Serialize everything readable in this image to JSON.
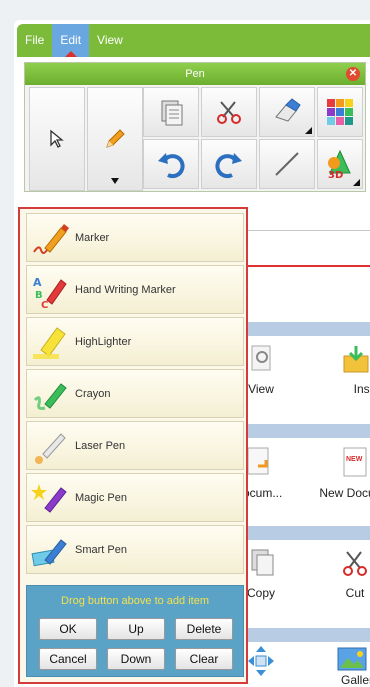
{
  "menubar": {
    "items": [
      {
        "label": "File"
      },
      {
        "label": "Edit"
      },
      {
        "label": "View"
      }
    ],
    "active": "Edit"
  },
  "pen_panel": {
    "title": "Pen",
    "tools": [
      "select-arrow-icon",
      "pencil-icon",
      "paste-icon",
      "scissors-icon",
      "eraser-icon",
      "color-grid-icon",
      "undo-icon",
      "redo-icon",
      "line-icon",
      "shapes-3d-icon"
    ]
  },
  "background": {
    "row1": [
      "View",
      "Inser"
    ],
    "row2": [
      "t Docum...",
      "New Docu"
    ],
    "row2_badge": "NEW",
    "row3": [
      "Copy",
      "Cut"
    ],
    "row4": [
      "",
      "Galler"
    ]
  },
  "dropdown": {
    "items": [
      {
        "label": "Marker",
        "icon": "marker-icon"
      },
      {
        "label": "Hand Writing Marker",
        "icon": "handwriting-marker-icon"
      },
      {
        "label": "HighLighter",
        "icon": "highlighter-icon"
      },
      {
        "label": "Crayon",
        "icon": "crayon-icon"
      },
      {
        "label": "Laser Pen",
        "icon": "laser-pen-icon"
      },
      {
        "label": "Magic Pen",
        "icon": "magic-pen-icon"
      },
      {
        "label": "Smart Pen",
        "icon": "smart-pen-icon"
      }
    ],
    "drag_message": "Drog button above to add item",
    "buttons": {
      "ok": "OK",
      "up": "Up",
      "delete": "Delete",
      "cancel": "Cancel",
      "down": "Down",
      "clear": "Clear"
    }
  },
  "colors": {
    "menubar": "#7cbb3a",
    "active_tab": "#6aa7e0",
    "dropdown_border": "#d43c3c",
    "drag_area": "#5aa2c6",
    "drag_text": "#f5e14a"
  }
}
